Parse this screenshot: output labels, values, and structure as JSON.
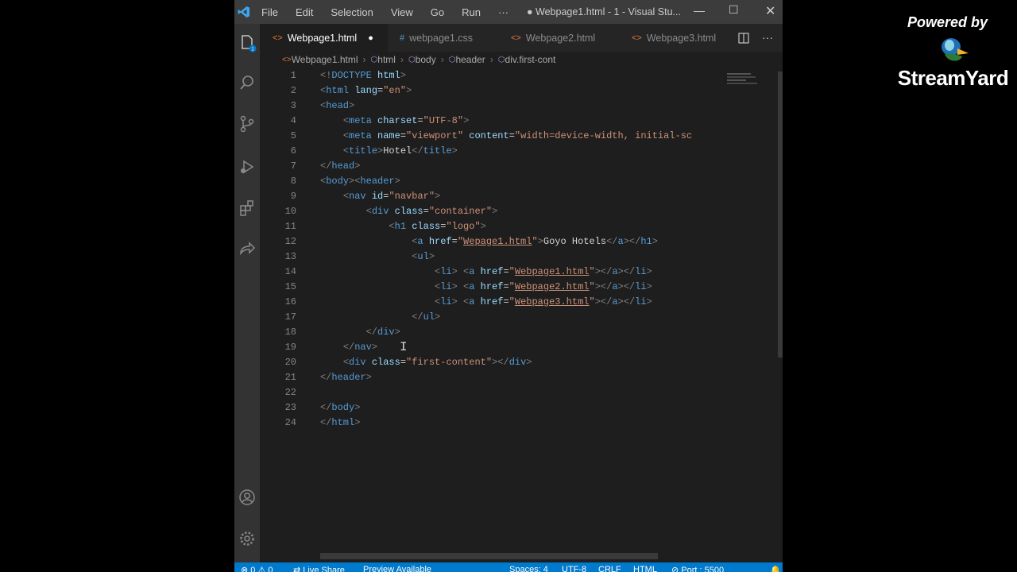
{
  "menu": [
    "File",
    "Edit",
    "Selection",
    "View",
    "Go",
    "Run",
    "···"
  ],
  "window_title": "● Webpage1.html - 1 - Visual Stu...",
  "tabs": [
    {
      "label": "Webpage1.html",
      "icon": "html-file-icon",
      "active": true,
      "modified": true
    },
    {
      "label": "webpage1.css",
      "icon": "css-file-icon",
      "active": false
    },
    {
      "label": "Webpage2.html",
      "icon": "html-file-icon",
      "active": false
    },
    {
      "label": "Webpage3.html",
      "icon": "html-file-icon",
      "active": false
    }
  ],
  "breadcrumb": [
    "Webpage1.html",
    "html",
    "body",
    "header",
    "div.first-cont"
  ],
  "lines": [
    {
      "n": "1",
      "tokens": [
        [
          "p",
          "<!"
        ],
        [
          "t",
          "DOCTYPE"
        ],
        [
          "x",
          " "
        ],
        [
          "a",
          "html"
        ],
        [
          "p",
          ">"
        ]
      ]
    },
    {
      "n": "2",
      "tokens": [
        [
          "p",
          "<"
        ],
        [
          "t",
          "html"
        ],
        [
          "x",
          " "
        ],
        [
          "a",
          "lang"
        ],
        [
          "x",
          "="
        ],
        [
          "s",
          "\"en\""
        ],
        [
          "p",
          ">"
        ]
      ]
    },
    {
      "n": "3",
      "tokens": [
        [
          "p",
          "<"
        ],
        [
          "t",
          "head"
        ],
        [
          "p",
          ">"
        ]
      ]
    },
    {
      "n": "4",
      "tokens": [
        [
          "x",
          "    "
        ],
        [
          "p",
          "<"
        ],
        [
          "t",
          "meta"
        ],
        [
          "x",
          " "
        ],
        [
          "a",
          "charset"
        ],
        [
          "x",
          "="
        ],
        [
          "s",
          "\"UTF-8\""
        ],
        [
          "p",
          ">"
        ]
      ]
    },
    {
      "n": "5",
      "tokens": [
        [
          "x",
          "    "
        ],
        [
          "p",
          "<"
        ],
        [
          "t",
          "meta"
        ],
        [
          "x",
          " "
        ],
        [
          "a",
          "name"
        ],
        [
          "x",
          "="
        ],
        [
          "s",
          "\"viewport\""
        ],
        [
          "x",
          " "
        ],
        [
          "a",
          "content"
        ],
        [
          "x",
          "="
        ],
        [
          "s",
          "\"width=device-width, initial-sc"
        ]
      ]
    },
    {
      "n": "6",
      "tokens": [
        [
          "x",
          "    "
        ],
        [
          "p",
          "<"
        ],
        [
          "t",
          "title"
        ],
        [
          "p",
          ">"
        ],
        [
          "x",
          "Hotel"
        ],
        [
          "p",
          "</"
        ],
        [
          "t",
          "title"
        ],
        [
          "p",
          ">"
        ]
      ]
    },
    {
      "n": "7",
      "tokens": [
        [
          "p",
          "</"
        ],
        [
          "t",
          "head"
        ],
        [
          "p",
          ">"
        ]
      ]
    },
    {
      "n": "8",
      "tokens": [
        [
          "p",
          "<"
        ],
        [
          "t",
          "body"
        ],
        [
          "p",
          "><"
        ],
        [
          "t",
          "header"
        ],
        [
          "p",
          ">"
        ]
      ]
    },
    {
      "n": "9",
      "tokens": [
        [
          "x",
          "    "
        ],
        [
          "p",
          "<"
        ],
        [
          "t",
          "nav"
        ],
        [
          "x",
          " "
        ],
        [
          "a",
          "id"
        ],
        [
          "x",
          "="
        ],
        [
          "s",
          "\"navbar\""
        ],
        [
          "p",
          ">"
        ]
      ]
    },
    {
      "n": "10",
      "tokens": [
        [
          "x",
          "        "
        ],
        [
          "p",
          "<"
        ],
        [
          "t",
          "div"
        ],
        [
          "x",
          " "
        ],
        [
          "a",
          "class"
        ],
        [
          "x",
          "="
        ],
        [
          "s",
          "\"container\""
        ],
        [
          "p",
          ">"
        ]
      ]
    },
    {
      "n": "11",
      "tokens": [
        [
          "x",
          "            "
        ],
        [
          "p",
          "<"
        ],
        [
          "t",
          "h1"
        ],
        [
          "x",
          " "
        ],
        [
          "a",
          "class"
        ],
        [
          "x",
          "="
        ],
        [
          "s",
          "\"logo\""
        ],
        [
          "p",
          ">"
        ]
      ]
    },
    {
      "n": "12",
      "tokens": [
        [
          "x",
          "                "
        ],
        [
          "p",
          "<"
        ],
        [
          "t",
          "a"
        ],
        [
          "x",
          " "
        ],
        [
          "a",
          "href"
        ],
        [
          "x",
          "="
        ],
        [
          "s",
          "\""
        ],
        [
          "su",
          "Wepage1.html"
        ],
        [
          "s",
          "\""
        ],
        [
          "p",
          ">"
        ],
        [
          "x",
          "Goyo Hotels"
        ],
        [
          "p",
          "</"
        ],
        [
          "t",
          "a"
        ],
        [
          "p",
          "></"
        ],
        [
          "t",
          "h1"
        ],
        [
          "p",
          ">"
        ]
      ]
    },
    {
      "n": "13",
      "tokens": [
        [
          "x",
          "                "
        ],
        [
          "p",
          "<"
        ],
        [
          "t",
          "ul"
        ],
        [
          "p",
          ">"
        ]
      ]
    },
    {
      "n": "14",
      "tokens": [
        [
          "x",
          "                    "
        ],
        [
          "p",
          "<"
        ],
        [
          "t",
          "li"
        ],
        [
          "p",
          "> <"
        ],
        [
          "t",
          "a"
        ],
        [
          "x",
          " "
        ],
        [
          "a",
          "href"
        ],
        [
          "x",
          "="
        ],
        [
          "s",
          "\""
        ],
        [
          "su",
          "Webpage1.html"
        ],
        [
          "s",
          "\""
        ],
        [
          "p",
          "></"
        ],
        [
          "t",
          "a"
        ],
        [
          "p",
          "></"
        ],
        [
          "t",
          "li"
        ],
        [
          "p",
          ">"
        ]
      ]
    },
    {
      "n": "15",
      "tokens": [
        [
          "x",
          "                    "
        ],
        [
          "p",
          "<"
        ],
        [
          "t",
          "li"
        ],
        [
          "p",
          "> <"
        ],
        [
          "t",
          "a"
        ],
        [
          "x",
          " "
        ],
        [
          "a",
          "href"
        ],
        [
          "x",
          "="
        ],
        [
          "s",
          "\""
        ],
        [
          "su",
          "Webpage2.html"
        ],
        [
          "s",
          "\""
        ],
        [
          "p",
          "></"
        ],
        [
          "t",
          "a"
        ],
        [
          "p",
          "></"
        ],
        [
          "t",
          "li"
        ],
        [
          "p",
          ">"
        ]
      ]
    },
    {
      "n": "16",
      "tokens": [
        [
          "x",
          "                    "
        ],
        [
          "p",
          "<"
        ],
        [
          "t",
          "li"
        ],
        [
          "p",
          "> <"
        ],
        [
          "t",
          "a"
        ],
        [
          "x",
          " "
        ],
        [
          "a",
          "href"
        ],
        [
          "x",
          "="
        ],
        [
          "s",
          "\""
        ],
        [
          "su",
          "Webpage3.html"
        ],
        [
          "s",
          "\""
        ],
        [
          "p",
          "></"
        ],
        [
          "t",
          "a"
        ],
        [
          "p",
          "></"
        ],
        [
          "t",
          "li"
        ],
        [
          "p",
          ">"
        ]
      ]
    },
    {
      "n": "17",
      "tokens": [
        [
          "x",
          "                "
        ],
        [
          "p",
          "</"
        ],
        [
          "t",
          "ul"
        ],
        [
          "p",
          ">"
        ]
      ]
    },
    {
      "n": "18",
      "tokens": [
        [
          "x",
          "        "
        ],
        [
          "p",
          "</"
        ],
        [
          "t",
          "div"
        ],
        [
          "p",
          ">"
        ]
      ]
    },
    {
      "n": "19",
      "tokens": [
        [
          "x",
          "    "
        ],
        [
          "p",
          "</"
        ],
        [
          "t",
          "nav"
        ],
        [
          "p",
          ">"
        ]
      ]
    },
    {
      "n": "20",
      "tokens": [
        [
          "x",
          "    "
        ],
        [
          "p",
          "<"
        ],
        [
          "t",
          "div"
        ],
        [
          "x",
          " "
        ],
        [
          "a",
          "class"
        ],
        [
          "x",
          "="
        ],
        [
          "s",
          "\"first-content\""
        ],
        [
          "p",
          "></"
        ],
        [
          "t",
          "div"
        ],
        [
          "p",
          ">"
        ]
      ]
    },
    {
      "n": "21",
      "tokens": [
        [
          "p",
          "</"
        ],
        [
          "t",
          "header"
        ],
        [
          "p",
          ">"
        ]
      ]
    },
    {
      "n": "22",
      "tokens": []
    },
    {
      "n": "23",
      "tokens": [
        [
          "p",
          "</"
        ],
        [
          "t",
          "body"
        ],
        [
          "p",
          ">"
        ]
      ]
    },
    {
      "n": "24",
      "tokens": [
        [
          "p",
          "</"
        ],
        [
          "t",
          "html"
        ],
        [
          "p",
          ">"
        ]
      ]
    }
  ],
  "statusbar": {
    "errors": "⊗ 0 ⚠ 0",
    "live_share": "Live Share",
    "preview": "Preview Available",
    "spaces": "Spaces: 4",
    "encoding": "UTF-8",
    "eol": "CRLF",
    "language": "HTML",
    "port": "Port : 5500"
  },
  "overlay": {
    "powered_by": "Powered by",
    "brand": "StreamYard"
  }
}
